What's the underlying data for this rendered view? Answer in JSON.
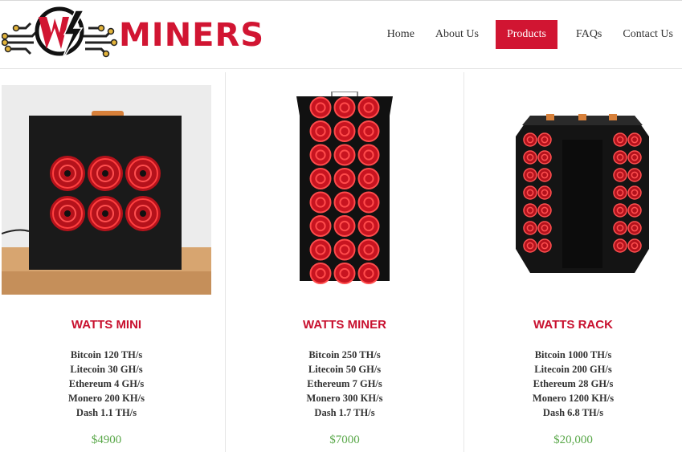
{
  "header": {
    "logo_text": "MINERS",
    "nav": [
      {
        "label": "Home"
      },
      {
        "label": "About Us"
      },
      {
        "label": "Products"
      },
      {
        "label": "FAQs"
      },
      {
        "label": "Contact Us"
      }
    ],
    "active_nav": "Products"
  },
  "products": [
    {
      "name": "WATTS MINI",
      "specs": [
        "Bitcoin 120 TH/s",
        "Litecoin 30 GH/s",
        "Ethereum 4 GH/s",
        "Monero 200 KH/s",
        "Dash 1.1 TH/s"
      ],
      "price": "$4900"
    },
    {
      "name": "WATTS MINER",
      "specs": [
        "Bitcoin 250 TH/s",
        "Litecoin 50 GH/s",
        "Ethereum 7 GH/s",
        "Monero 300 KH/s",
        "Dash 1.7 TH/s"
      ],
      "price": "$7000"
    },
    {
      "name": "WATTS RACK",
      "specs": [
        "Bitcoin 1000 TH/s",
        "Litecoin 200 GH/s",
        "Ethereum 28 GH/s",
        "Monero 1200 KH/s",
        "Dash 6.8 TH/s"
      ],
      "price": "$20,000"
    }
  ],
  "colors": {
    "brand_red": "#d11532",
    "price_green": "#5aa84a",
    "fan_red": "#e0202a"
  }
}
